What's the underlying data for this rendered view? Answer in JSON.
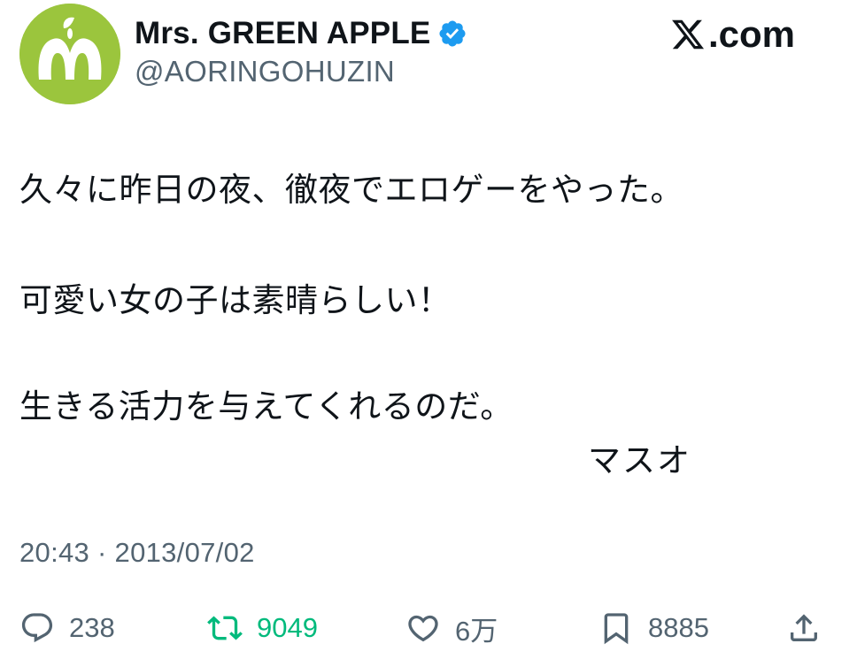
{
  "account": {
    "display_name": "Mrs. GREEN APPLE",
    "handle": "@AORINGOHUZIN",
    "verified": true,
    "avatar_icon": "green-apple-m-logo",
    "avatar_color": "#9bc53d"
  },
  "watermark": {
    "text": ".com",
    "icon": "x-logo-icon"
  },
  "tweet": {
    "lines": [
      "久々に昨日の夜、徹夜でエロゲーをやった。",
      "可愛い女の子は素晴らしい！",
      "生きる活力を与えてくれるのだ。"
    ],
    "signature": "マスオ",
    "timestamp": "20:43 · 2013/07/02"
  },
  "actions": {
    "reply_count": "238",
    "retweet_count": "9049",
    "like_count": "6万",
    "bookmark_count": "8885"
  },
  "colors": {
    "text": "#0f1419",
    "muted": "#536471",
    "retweet_green": "#00ba7c",
    "verified_blue": "#1d9bf0"
  }
}
